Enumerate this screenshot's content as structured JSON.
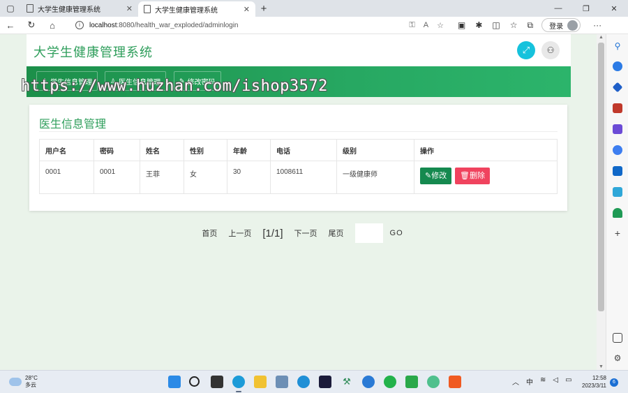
{
  "browser": {
    "tabs": [
      {
        "title": "大学生健康管理系统",
        "active": false
      },
      {
        "title": "大学生健康管理系统",
        "active": true
      }
    ],
    "url_host": "localhost",
    "url_rest": ":8080/health_war_exploded/adminlogin",
    "login_label": "登录"
  },
  "app": {
    "title": "大学生健康管理系统",
    "nav": [
      {
        "label": "学生信息管理",
        "icon": "user-icon"
      },
      {
        "label": "医生信息管理",
        "icon": "doctor-icon"
      },
      {
        "label": "修改密码",
        "icon": "pencil-icon"
      }
    ],
    "watermark": "https://www.huzhan.com/ishop3572"
  },
  "main": {
    "card_title": "医生信息管理",
    "columns": [
      "用户名",
      "密码",
      "姓名",
      "性别",
      "年龄",
      "电话",
      "级别",
      "操作"
    ],
    "rows": [
      {
        "username": "0001",
        "password": "0001",
        "name": "王菲",
        "gender": "女",
        "age": "30",
        "phone": "1008611",
        "level": "一级健康师"
      }
    ],
    "edit_label": "修改",
    "delete_label": "删除"
  },
  "pagination": {
    "first": "首页",
    "prev": "上一页",
    "current": "[1/1]",
    "next": "下一页",
    "last": "尾页",
    "go": "GO"
  },
  "taskbar": {
    "temperature": "28°C",
    "weather": "多云",
    "ime": "中",
    "time": "12:58",
    "date": "2023/3/11",
    "notifications": "6"
  },
  "colors": {
    "accent": "#2e9e5b",
    "nav_bg": "#27a862",
    "edit_button": "#15894f",
    "delete_button": "#f0435e",
    "expand_button": "#16c2dc"
  }
}
